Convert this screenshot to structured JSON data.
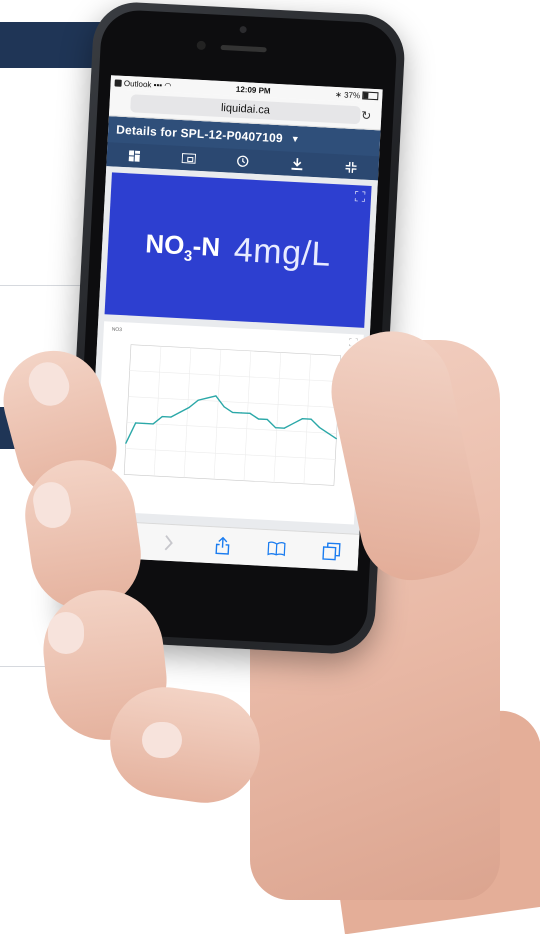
{
  "status_bar": {
    "carrier": "Outlook",
    "time": "12:09 PM",
    "battery": "37%"
  },
  "browser": {
    "url": "liquidai.ca"
  },
  "app": {
    "title": "Details for SPL-12-P0407109",
    "toolbar_icons": [
      "dashboard-icon",
      "device-icon",
      "clock-icon",
      "download-icon",
      "collapse-icon"
    ]
  },
  "metric": {
    "parameter_main": "NO",
    "parameter_sub": "3",
    "parameter_suffix": "-N",
    "value": "4mg/L",
    "background": "#2d3fd0"
  },
  "chart_data": {
    "type": "line",
    "title": "NO3",
    "x": [
      1,
      2,
      3,
      4,
      5,
      6,
      7,
      8,
      9,
      10,
      11,
      12,
      13,
      14,
      15,
      16,
      17,
      18,
      19,
      20,
      21,
      22,
      23,
      24,
      25
    ],
    "series": [
      {
        "values": [
          3.2,
          4.0,
          4.0,
          4.0,
          4.3,
          4.3,
          4.5,
          4.7,
          5.0,
          5.1,
          5.2,
          4.8,
          4.6,
          4.6,
          4.6,
          4.4,
          4.4,
          4.1,
          4.1,
          4.3,
          4.5,
          4.5,
          4.2,
          4.0,
          3.8
        ]
      }
    ],
    "ylim": [
      2,
      7
    ],
    "grid": true,
    "color": "#2ba8a8"
  },
  "safari_icons": [
    "back-icon",
    "forward-icon",
    "share-icon",
    "bookmarks-icon",
    "tabs-icon"
  ]
}
